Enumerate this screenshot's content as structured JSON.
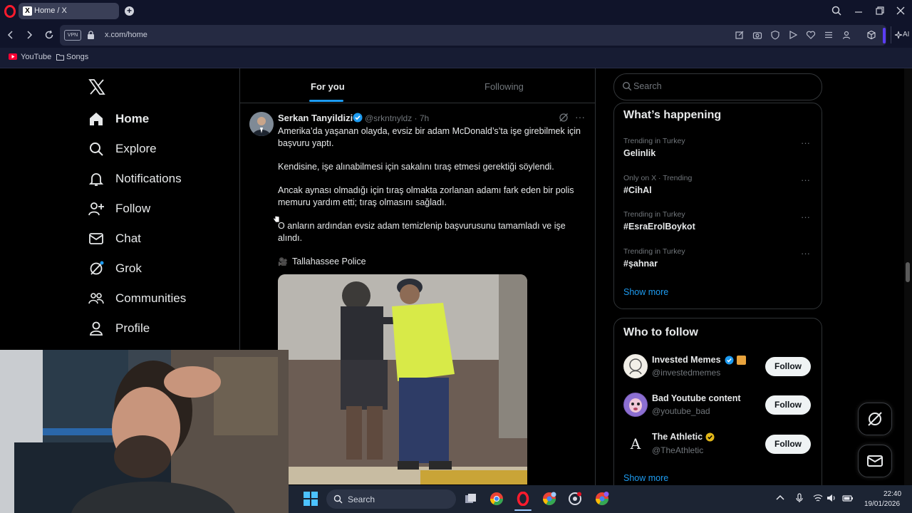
{
  "browser": {
    "tab_title": "Home / X",
    "tab_favicon": "X",
    "vpn_label": "VPN",
    "url": "x.com/home",
    "ai_label": "AI",
    "bookmarks": [
      "YouTube",
      "Songs"
    ]
  },
  "nav": {
    "items": [
      {
        "label": "Home",
        "icon": "home-icon"
      },
      {
        "label": "Explore",
        "icon": "search-icon"
      },
      {
        "label": "Notifications",
        "icon": "bell-icon"
      },
      {
        "label": "Follow",
        "icon": "follow-icon"
      },
      {
        "label": "Chat",
        "icon": "mail-icon"
      },
      {
        "label": "Grok",
        "icon": "grok-icon"
      },
      {
        "label": "Communities",
        "icon": "communities-icon"
      },
      {
        "label": "Profile",
        "icon": "profile-icon"
      }
    ]
  },
  "feed": {
    "tabs": [
      "For you",
      "Following"
    ],
    "active_tab": "For you"
  },
  "tweet": {
    "author": "Serkan Tanyildizi",
    "handle_time": "@srkntnyldz · 7h",
    "paragraphs": [
      "Amerika’da yaşanan olayda, evsiz bir adam McDonald’s’ta işe girebilmek için başvuru yaptı.",
      "Kendisine, işe alınabilmesi için sakalını tıraş etmesi gerektiği söylendi.",
      "Ancak aynası olmadığı için tıraş olmakta zorlanan adamı fark eden bir polis memuru yardım etti; tıraş olmasını sağladı.",
      "O anların ardından evsiz adam temizlenip başvurusunu tamamladı ve işe alındı."
    ],
    "credit_icon": "🎥",
    "credit": "Tallahassee Police"
  },
  "sidebar": {
    "search_placeholder": "Search",
    "trends_title": "What’s happening",
    "trends": [
      {
        "meta": "Trending in Turkey",
        "name": "Gelinlik"
      },
      {
        "meta": "Only on X · Trending",
        "name": "#CihAl"
      },
      {
        "meta": "Trending in Turkey",
        "name": "#EsraErolBoykot"
      },
      {
        "meta": "Trending in Turkey",
        "name": "#şahnar"
      }
    ],
    "show_more": "Show more",
    "more_glyph": "···",
    "wtf_title": "Who to follow",
    "follow_suggestions": [
      {
        "name": "Invested Memes",
        "handle": "@investedmemes",
        "button": "Follow"
      },
      {
        "name": "Bad Youtube content",
        "handle": "@youtube_bad",
        "button": "Follow"
      },
      {
        "name": "The Athletic",
        "handle": "@TheAthletic",
        "button": "Follow"
      }
    ],
    "athletic_glyph": "A"
  },
  "taskbar": {
    "search_label": "Search",
    "time": "22:40",
    "date": "19/01/2026"
  },
  "colors": {
    "accent": "#1d9bf0",
    "background": "#000000",
    "chrome": "#10142a"
  }
}
